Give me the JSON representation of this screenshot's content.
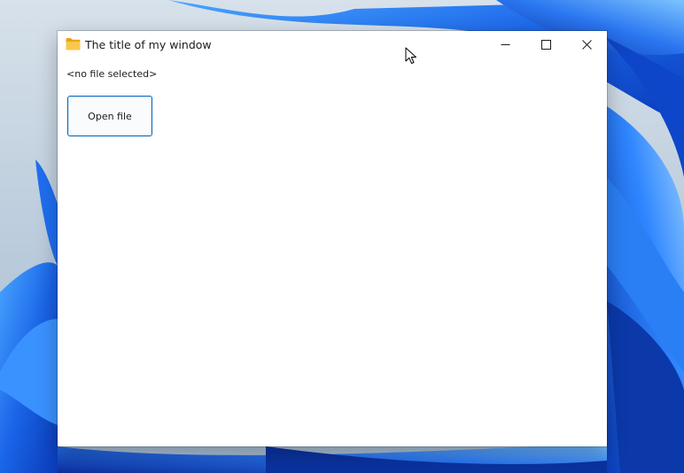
{
  "window": {
    "title": "The title of my window",
    "app_icon": "folder-icon"
  },
  "caption_buttons": {
    "minimize_icon": "minimize-icon",
    "maximize_icon": "maximize-icon",
    "close_icon": "close-icon"
  },
  "content": {
    "status_text": "<no file selected>",
    "open_button_label": "Open file"
  },
  "colors": {
    "button_border": "#0067c0",
    "folder_yellow": "#f8c84a",
    "wallpaper_blue": "#1a5fe0"
  }
}
